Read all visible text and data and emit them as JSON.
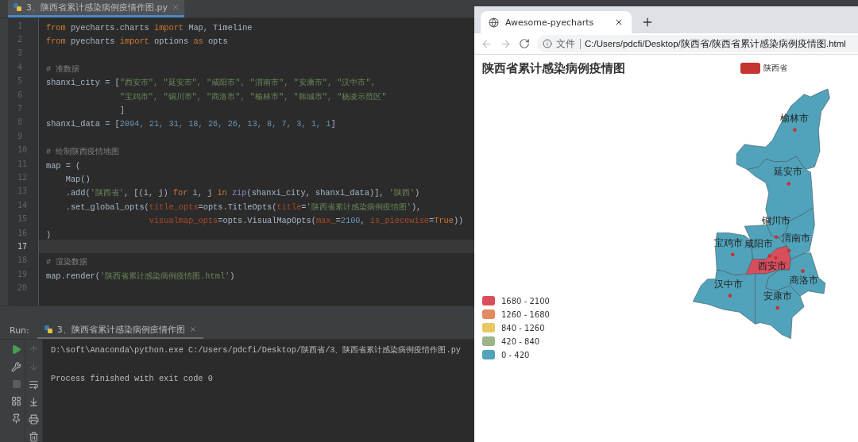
{
  "editor": {
    "tab": {
      "title": "3、陕西省累计感染病例疫情作图.py",
      "selected": true
    },
    "lines": [
      {
        "n": "1",
        "current": false,
        "tokens": [
          {
            "kind": "kw",
            "t": "from"
          },
          {
            "kind": "pl",
            "t": " pyecharts.charts "
          },
          {
            "kind": "kw",
            "t": "import"
          },
          {
            "kind": "pl",
            "t": " Map, Timeline"
          }
        ]
      },
      {
        "n": "2",
        "current": false,
        "tokens": [
          {
            "kind": "kw",
            "t": "from"
          },
          {
            "kind": "pl",
            "t": " pyecharts "
          },
          {
            "kind": "kw",
            "t": "import"
          },
          {
            "kind": "pl",
            "t": " options "
          },
          {
            "kind": "kw",
            "t": "as"
          },
          {
            "kind": "pl",
            "t": " opts"
          }
        ]
      },
      {
        "n": "3",
        "current": false
      },
      {
        "n": "4",
        "current": false,
        "tokens": [
          {
            "kind": "cm",
            "t": "# 准数据"
          }
        ]
      },
      {
        "n": "5",
        "current": false,
        "tokens": [
          {
            "kind": "pl",
            "t": "shanxi_city = ["
          },
          {
            "kind": "str",
            "t": "\"西安市\", \"延安市\", \"咸阳市\", \"渭南市\", \"安康市\", \"汉中市\","
          }
        ]
      },
      {
        "n": "6",
        "current": false,
        "tokens": [
          {
            "kind": "str",
            "t": "               \"宝鸡市\", \"铜川市\", \"商洛市\", \"榆林市\", \"韩城市\", \"杨凌示范区\""
          }
        ]
      },
      {
        "n": "7",
        "current": false,
        "tokens": [
          {
            "kind": "pl",
            "t": "               ]"
          }
        ]
      },
      {
        "n": "8",
        "current": false,
        "tokens": [
          {
            "kind": "pl",
            "t": "shanxi_data = ["
          },
          {
            "kind": "num",
            "t": "2094, 21, 31, 18, 26, 26, 13, 8, 7, 3, 1, 1"
          },
          {
            "kind": "pl",
            "t": "]"
          }
        ]
      },
      {
        "n": "9",
        "current": false
      },
      {
        "n": "10",
        "current": false,
        "tokens": [
          {
            "kind": "cm",
            "t": "# 绘制陕西疫情地图"
          }
        ]
      },
      {
        "n": "11",
        "current": false,
        "tokens": [
          {
            "kind": "pl",
            "t": "map = ("
          }
        ]
      },
      {
        "n": "12",
        "current": false,
        "tokens": [
          {
            "kind": "pl",
            "t": "    Map()"
          }
        ]
      },
      {
        "n": "13",
        "current": false,
        "tokens": [
          {
            "kind": "pl",
            "t": "    .add("
          },
          {
            "kind": "str",
            "t": "'陕西省'"
          },
          {
            "kind": "pl",
            "t": ", [(i, j) "
          },
          {
            "kind": "kw",
            "t": "for"
          },
          {
            "kind": "pl",
            "t": " i, j "
          },
          {
            "kind": "kw",
            "t": "in"
          },
          {
            "kind": "fn",
            "t": " zip"
          },
          {
            "kind": "pl",
            "t": "(shanxi_city, shanxi_data)], "
          },
          {
            "kind": "str",
            "t": "'陕西'"
          },
          {
            "kind": "pl",
            "t": ")"
          }
        ]
      },
      {
        "n": "14",
        "current": false,
        "tokens": [
          {
            "kind": "pl",
            "t": "    .set_global_opts("
          },
          {
            "kind": "par",
            "t": "title_opts"
          },
          {
            "kind": "pl",
            "t": "=opts.TitleOpts("
          },
          {
            "kind": "par",
            "t": "title"
          },
          {
            "kind": "pl",
            "t": "="
          },
          {
            "kind": "str",
            "t": "'陕西省累计感染病例疫情图'"
          },
          {
            "kind": "pl",
            "t": "),"
          }
        ]
      },
      {
        "n": "15",
        "current": false,
        "tokens": [
          {
            "kind": "par",
            "t": "                     visualmap_opts"
          },
          {
            "kind": "pl",
            "t": "=opts.VisualMapOpts("
          },
          {
            "kind": "par",
            "t": "max_"
          },
          {
            "kind": "pl",
            "t": "="
          },
          {
            "kind": "num",
            "t": "2100"
          },
          {
            "kind": "pl",
            "t": ", "
          },
          {
            "kind": "par",
            "t": "is_piecewise"
          },
          {
            "kind": "pl",
            "t": "="
          },
          {
            "kind": "kw",
            "t": "True"
          },
          {
            "kind": "pl",
            "t": "))"
          }
        ]
      },
      {
        "n": "16",
        "current": false,
        "tokens": [
          {
            "kind": "pl",
            "t": ")"
          }
        ]
      },
      {
        "n": "17",
        "current": true
      },
      {
        "n": "18",
        "current": false,
        "tokens": [
          {
            "kind": "cm",
            "t": "# 渲染数据"
          }
        ]
      },
      {
        "n": "19",
        "current": false,
        "tokens": [
          {
            "kind": "pl",
            "t": "map.render("
          },
          {
            "kind": "str",
            "t": "'陕西省累计感染病例疫情图.html'"
          },
          {
            "kind": "pl",
            "t": ")"
          }
        ]
      },
      {
        "n": "20",
        "current": false
      }
    ]
  },
  "run": {
    "label": "Run:",
    "tab": {
      "title": "3、陕西省累计感染病例疫情作图",
      "selected": true
    },
    "output": [
      "D:\\soft\\Anaconda\\python.exe C:/Users/pdcfi/Desktop/陕西省/3、陕西省累计感染病例疫情作图.py",
      "Process finished with exit code 0"
    ]
  },
  "browser": {
    "tab": {
      "title": "Awesome-pyecharts",
      "selected": true
    },
    "address": {
      "scheme": "文件",
      "url": "C:/Users/pdcfi/Desktop/陕西省/陕西省累计感染病例疫情图.html"
    },
    "chart": {
      "title": "陕西省累计感染病例疫情图",
      "legend": {
        "name": "陕西省",
        "color": "#c23531"
      },
      "pieces": [
        {
          "label": "1680 - 2100",
          "color": "#d94e5d"
        },
        {
          "label": "1260 - 1680",
          "color": "#e38b60"
        },
        {
          "label": "840 - 1260",
          "color": "#eac763"
        },
        {
          "label": "420 - 840",
          "color": "#9db38a"
        },
        {
          "label": "0 - 420",
          "color": "#50a3ba"
        }
      ],
      "cities": [
        {
          "name": "榆林市",
          "color": "#50a3ba"
        },
        {
          "name": "延安市",
          "color": "#50a3ba"
        },
        {
          "name": "铜川市",
          "color": "#50a3ba"
        },
        {
          "name": "渭南市",
          "color": "#50a3ba"
        },
        {
          "name": "咸阳市",
          "color": "#50a3ba"
        },
        {
          "name": "宝鸡市",
          "color": "#50a3ba"
        },
        {
          "name": "西安市",
          "color": "#d94e5d"
        },
        {
          "name": "商洛市",
          "color": "#50a3ba"
        },
        {
          "name": "汉中市",
          "color": "#50a3ba"
        },
        {
          "name": "安康市",
          "color": "#50a3ba"
        }
      ]
    }
  }
}
